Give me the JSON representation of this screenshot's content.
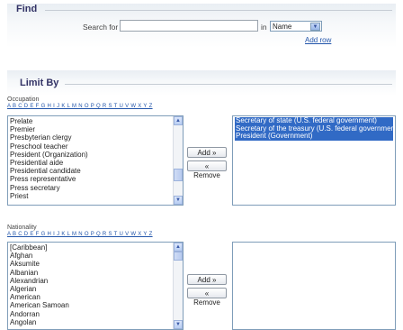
{
  "find": {
    "heading": "Find",
    "search_label": "Search for",
    "search_value": "",
    "in_label": "in",
    "field_select": "Name",
    "add_row_link": "Add row"
  },
  "limit_by": {
    "heading": "Limit By"
  },
  "alphabet": "A B C D E F G H I J K L M N O P Q R S T U V W X Y Z",
  "occupation": {
    "label": "Occupation",
    "available": [
      "Prelate",
      "Premier",
      "Presbyterian clergy",
      "Preschool teacher",
      "President (Organization)",
      "Presidential aide",
      "Presidential candidate",
      "Press representative",
      "Press secretary",
      "Priest"
    ],
    "selected": [
      "Secretary of state (U.S. federal government)",
      "Secretary of the treasury (U.S. federal government)",
      "President (Government)"
    ],
    "add_button": "Add »",
    "remove_button": "« Remove"
  },
  "nationality": {
    "label": "Nationality",
    "available": [
      "[Caribbean]",
      "Afghan",
      "Aksumite",
      "Albanian",
      "Alexandrian",
      "Algerian",
      "American",
      "American Samoan",
      "Andorran",
      "Angolan"
    ],
    "selected": [],
    "add_button": "Add »",
    "remove_button": "« Remove"
  }
}
